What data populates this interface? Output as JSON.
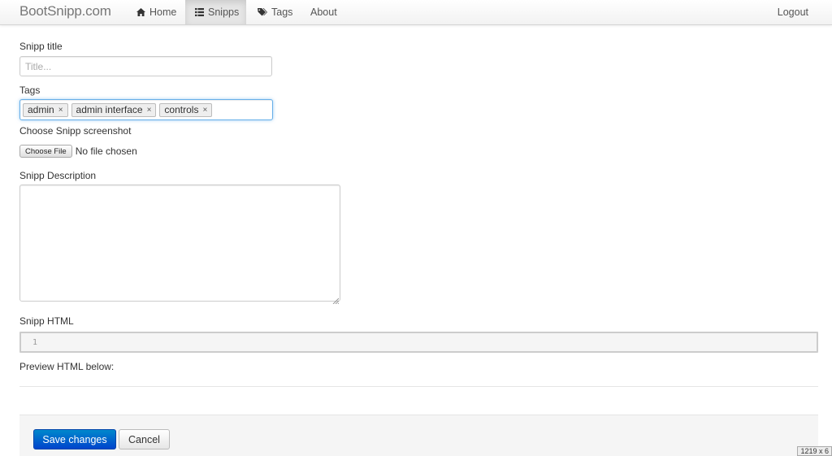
{
  "navbar": {
    "brand": "BootSnipp.com",
    "items": [
      {
        "label": "Home",
        "icon": "home-icon",
        "active": false
      },
      {
        "label": "Snipps",
        "icon": "list-icon",
        "active": true
      },
      {
        "label": "Tags",
        "icon": "tag-icon",
        "active": false
      },
      {
        "label": "About",
        "active": false
      }
    ],
    "logout_label": "Logout"
  },
  "form": {
    "title_label": "Snipp title",
    "title_placeholder": "Title...",
    "title_value": "",
    "tags_label": "Tags",
    "tags": [
      "admin",
      "admin interface",
      "controls"
    ],
    "tag_remove_glyph": "×",
    "screenshot_label": "Choose Snipp screenshot",
    "file_button_label": "Choose File",
    "file_status": "No file chosen",
    "description_label": "Snipp Description",
    "description_value": "",
    "html_label": "Snipp HTML",
    "code_line_number": "1",
    "preview_label": "Preview HTML below:"
  },
  "actions": {
    "save_label": "Save changes",
    "cancel_label": "Cancel"
  },
  "window_size_badge": "1219 x 6",
  "colors": {
    "primary": "#0055cc",
    "focus_border": "#66afe9",
    "nav_active_bg": "#e5e5e5"
  }
}
